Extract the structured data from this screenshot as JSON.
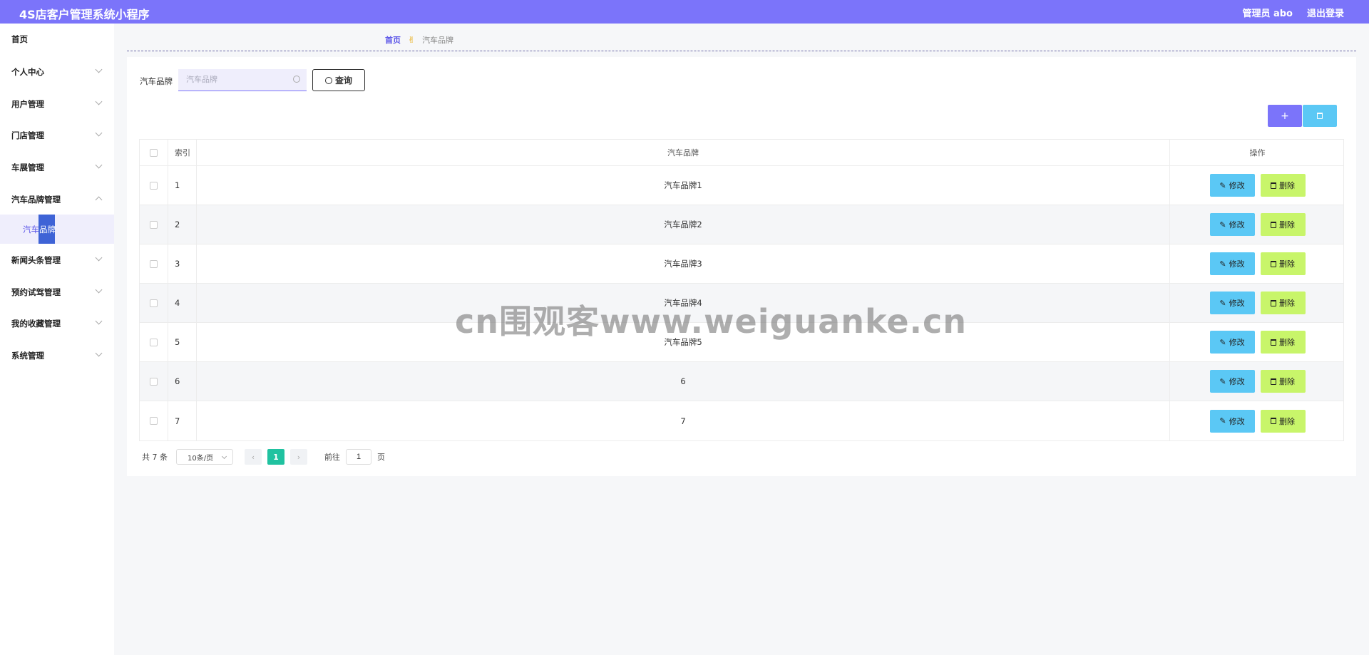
{
  "header": {
    "title": "4S店客户管理系统小程序",
    "admin_label": "管理员 abo",
    "logout_label": "退出登录"
  },
  "sidebar": {
    "items": [
      {
        "label": "首页"
      },
      {
        "label": "个人中心"
      },
      {
        "label": "用户管理"
      },
      {
        "label": "门店管理"
      },
      {
        "label": "车展管理"
      },
      {
        "label": "汽车品牌管理"
      },
      {
        "label": "新闻头条管理"
      },
      {
        "label": "预约试驾管理"
      },
      {
        "label": "我的收藏管理"
      },
      {
        "label": "系统管理"
      }
    ],
    "submenu": {
      "label_a": "汽车",
      "label_b": "品牌"
    }
  },
  "breadcrumb": {
    "home": "首页",
    "current": "汽车品牌"
  },
  "search": {
    "label": "汽车品牌",
    "placeholder": "汽车品牌",
    "query_label": "查询"
  },
  "toolbar": {
    "add_icon": "+"
  },
  "table": {
    "headers": {
      "index": "索引",
      "brand": "汽车品牌",
      "ops": "操作"
    },
    "rows": [
      {
        "index": "1",
        "brand": "汽车品牌1"
      },
      {
        "index": "2",
        "brand": "汽车品牌2"
      },
      {
        "index": "3",
        "brand": "汽车品牌3"
      },
      {
        "index": "4",
        "brand": "汽车品牌4"
      },
      {
        "index": "5",
        "brand": "汽车品牌5"
      },
      {
        "index": "6",
        "brand": "6"
      },
      {
        "index": "7",
        "brand": "7"
      }
    ],
    "edit_label": "修改",
    "delete_label": "删除"
  },
  "pagination": {
    "total": "共 7 条",
    "page_size": "10条/页",
    "current_page": "1",
    "goto_label": "前往",
    "goto_value": "1",
    "page_unit": "页"
  },
  "watermark": "cn围观客www.weiguanke.cn",
  "colors": {
    "primary": "#7b74fa",
    "info": "#5bc8f5",
    "lime": "#c8f56a",
    "active_page": "#20c2a0"
  }
}
